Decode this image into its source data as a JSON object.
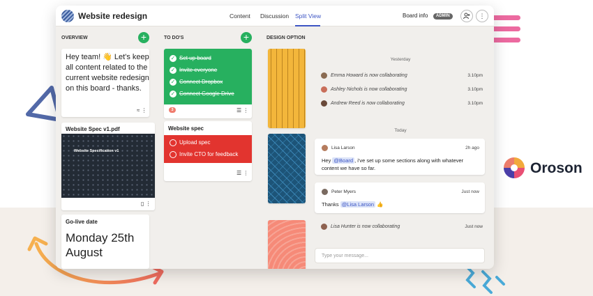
{
  "app": {
    "title": "Website redesign",
    "nav": [
      "Content",
      "Discussion",
      "Split View"
    ],
    "active_nav": "Split View",
    "board_info": "Board info",
    "admin_badge": "ADMIN",
    "accent_color": "#3d55c4"
  },
  "columns": {
    "overview": "OVERVIEW",
    "todos": "TO DO'S",
    "design": "DESIGN OPTION"
  },
  "overview": {
    "note_text": "Hey team! 👋 Let's keep all content related to the current website redesign on this board - thanks.",
    "pdf_title": "Website Spec v1.pdf",
    "pdf_cover_text": "Website Specification v1",
    "golive_title": "Go-live date",
    "golive_date": "Monday 25th August"
  },
  "todos": {
    "list1": {
      "color": "#27b05f",
      "items": [
        "Set up board",
        "Invite everyone",
        "Connect Dropbox",
        "Connect Google Drive"
      ],
      "badge": "3"
    },
    "list2": {
      "title": "Website spec",
      "color": "#e2342f",
      "items": [
        "Upload spec",
        "Invite CTO for feedback"
      ]
    }
  },
  "chat": {
    "yesterday_label": "Yesterday",
    "yesterday_activity": [
      {
        "text": "Emma Howard is now collaborating",
        "time": "3.10pm"
      },
      {
        "text": "Ashley Nichols is now collaborating",
        "time": "3.10pm"
      },
      {
        "text": "Andrew Reed is now collaborating",
        "time": "3.10pm"
      }
    ],
    "today_label": "Today",
    "messages": [
      {
        "author": "Lisa Larson",
        "time": "2h ago",
        "pre": "Hey ",
        "mention": "@Board",
        "post": ", i've set up some sections along with whatever content we have so far."
      },
      {
        "author": "Peter Myers",
        "time": "Just now",
        "pre": "Thanks ",
        "mention": "@Lisa Larson",
        "post": " 👍"
      }
    ],
    "today_activity": {
      "text": "Lisa Hunter is now collaborating",
      "time": "Just now"
    },
    "input_placeholder": "Type your message..."
  },
  "brand": {
    "name": "Oroson"
  }
}
